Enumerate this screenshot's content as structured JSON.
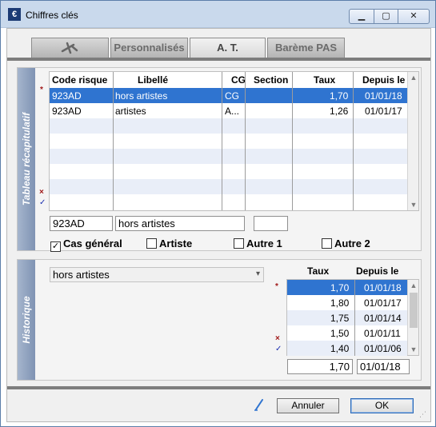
{
  "window": {
    "title": "Chiffres clés",
    "app_icon": "€"
  },
  "tabs": [
    {
      "label": "",
      "icon": "pen-tool-icon"
    },
    {
      "label": "Personnalisés"
    },
    {
      "label": "A. T."
    },
    {
      "label": "Barème PAS"
    }
  ],
  "active_tab": 2,
  "summary": {
    "side_label": "Tableau récapitulatif",
    "columns": [
      "Code risque",
      "Libellé",
      "CG",
      "Section",
      "Taux",
      "Depuis le"
    ],
    "rows": [
      {
        "code": "923AD",
        "libelle": "hors artistes",
        "cg": "CG",
        "section": "",
        "taux": "1,70",
        "depuis": "01/01/18"
      },
      {
        "code": "923AD",
        "libelle": "artistes",
        "cg": "A...",
        "section": "",
        "taux": "1,26",
        "depuis": "01/01/17"
      }
    ],
    "edit": {
      "code": "923AD",
      "libelle": "hors artistes",
      "cg": ""
    },
    "checkboxes": [
      {
        "label": "Cas général",
        "checked": true
      },
      {
        "label": "Artiste",
        "checked": false
      },
      {
        "label": "Autre 1",
        "checked": false
      },
      {
        "label": "Autre 2",
        "checked": false
      }
    ],
    "check_mark": "✓"
  },
  "history": {
    "side_label": "Historique",
    "selected": "hors artistes",
    "columns": [
      "Taux",
      "Depuis le"
    ],
    "rows": [
      {
        "taux": "1,70",
        "depuis": "01/01/18"
      },
      {
        "taux": "1,80",
        "depuis": "01/01/17"
      },
      {
        "taux": "1,75",
        "depuis": "01/01/14"
      },
      {
        "taux": "1,50",
        "depuis": "01/01/11"
      },
      {
        "taux": "1,40",
        "depuis": "01/01/06"
      }
    ],
    "edit": {
      "taux": "1,70",
      "depuis": "01/01/18"
    }
  },
  "buttons": {
    "cancel": "Annuler",
    "ok": "OK"
  },
  "markers": {
    "star": "*",
    "delete": "×",
    "validate": "✓"
  }
}
